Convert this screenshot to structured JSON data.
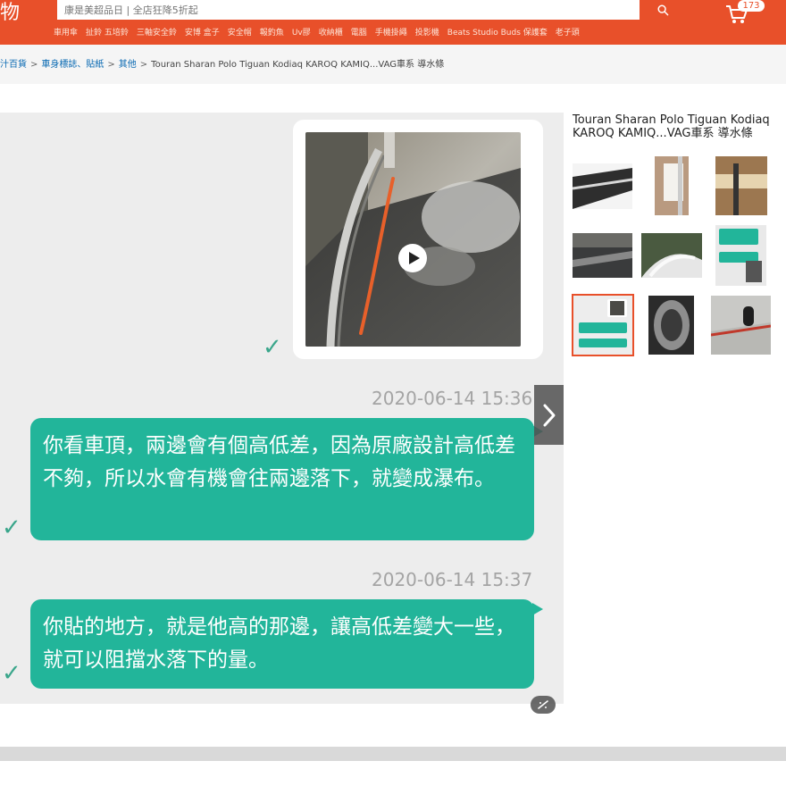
{
  "header": {
    "logo_text": "物",
    "search_placeholder": "康是美超品日 | 全店狂降5折起",
    "cart_count": "173",
    "hot_keywords": [
      "車用傘",
      "扯鈴 五培鈴",
      "三軸安全鈴",
      "安博 盒子",
      "安全帽",
      "報釣魚",
      "Uv膠",
      "收納櫃",
      "電腦",
      "手機掛繩",
      "投影機",
      "Beats Studio Buds 保護套",
      "老子頭"
    ]
  },
  "breadcrumb": {
    "items": [
      "汁百貨",
      "車身標誌、貼紙",
      "其他"
    ],
    "separator": ">",
    "current": "Touran Sharan Polo Tiguan Kodiaq KAROQ KAMIQ...VAG車系 導水條"
  },
  "chat": {
    "messages": [
      {
        "timestamp": "2020-06-14 15:36",
        "text": "你看車頂，兩邊會有個高低差，因為原廠設計高低差不夠，所以水會有機會往兩邊落下，就變成瀑布。"
      },
      {
        "timestamp": "2020-06-14 15:37",
        "text": "你貼的地方，就是他高的那邊，讓高低差變大一些，就可以阻擋水落下的量。"
      }
    ]
  },
  "product": {
    "title": "Touran Sharan Polo Tiguan Kodiaq KAROQ KAMIQ...VAG車系 導水條",
    "thumbnails": [
      {
        "name": "roof-rail",
        "selected": false
      },
      {
        "name": "strip-hand",
        "selected": false
      },
      {
        "name": "ruler-measure",
        "selected": false
      },
      {
        "name": "car-roof-interior",
        "selected": false
      },
      {
        "name": "roof-strip-closeup",
        "selected": false
      },
      {
        "name": "chat-screenshot-1",
        "selected": false
      },
      {
        "name": "chat-screenshot-2",
        "selected": true
      },
      {
        "name": "strip-roll",
        "selected": false
      },
      {
        "name": "car-antenna-red",
        "selected": false
      }
    ]
  },
  "colors": {
    "brand": "#e8502a",
    "bubble": "#22b59a",
    "check": "#3aa68b",
    "viewer_bg": "#ededed"
  },
  "icons": {
    "search": "search-icon",
    "cart": "cart-icon",
    "next": "chevron-right-icon",
    "zoom": "zoom-icon",
    "play": "play-icon",
    "check": "check-icon"
  }
}
